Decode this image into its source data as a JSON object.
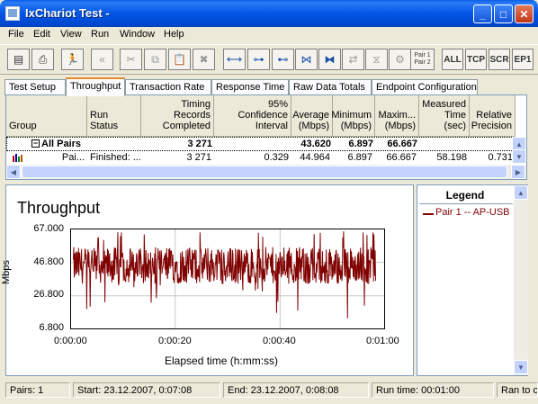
{
  "window": {
    "title": "IxChariot Test -"
  },
  "menu": [
    "File",
    "Edit",
    "View",
    "Run",
    "Window",
    "Help"
  ],
  "toolbar": {
    "text_buttons": [
      "ALL",
      "TCP",
      "SCR",
      "EP1"
    ],
    "pair_button": [
      "Pair 1",
      "Pair 2"
    ]
  },
  "tabs": [
    "Test Setup",
    "Throughput",
    "Transaction Rate",
    "Response Time",
    "Raw Data Totals",
    "Endpoint Configuration"
  ],
  "grid": {
    "headers": [
      "Group",
      "Run Status",
      "Timing Records Completed",
      "95% Confidence Interval",
      "Average (Mbps)",
      "Minimum (Mbps)",
      "Maxim... (Mbps)",
      "Measured Time (sec)",
      "Relative Precision"
    ],
    "group_row": {
      "label": "All Pairs",
      "records": "3 271",
      "average": "43.620",
      "minimum": "6.897",
      "maximum": "66.667"
    },
    "pair_row": {
      "group": "Pai...",
      "status": "Finished: ...",
      "records": "3 271",
      "ci": "0.329",
      "average": "44.964",
      "minimum": "6.897",
      "maximum": "66.667",
      "measured": "58.198",
      "precision": "0.731"
    }
  },
  "chart_data": {
    "type": "line",
    "title": "Throughput",
    "xlabel": "Elapsed time (h:mm:ss)",
    "ylabel": "Mbps",
    "yticks": [
      "67.000",
      "46.800",
      "26.800",
      "6.800"
    ],
    "xticks": [
      "0:00:00",
      "0:00:20",
      "0:00:40",
      "0:01:00"
    ],
    "ylim": [
      6.8,
      67.0
    ],
    "xlim": [
      0,
      60
    ],
    "grid": true,
    "series": [
      {
        "name": "Pair 1 -- AP-USB",
        "color": "#800000",
        "start": 0.6,
        "end": 58.2,
        "mean": 44.96,
        "min": 6.897,
        "max": 66.667
      }
    ]
  },
  "legend": {
    "title": "Legend",
    "entry": "Pair 1 -- AP-USB"
  },
  "status": {
    "pairs": "Pairs: 1",
    "start": "Start: 23.12.2007, 0:07:08",
    "end": "End: 23.12.2007, 0:08:08",
    "runtime": "Run time: 00:01:00",
    "ran": "Ran to c"
  }
}
